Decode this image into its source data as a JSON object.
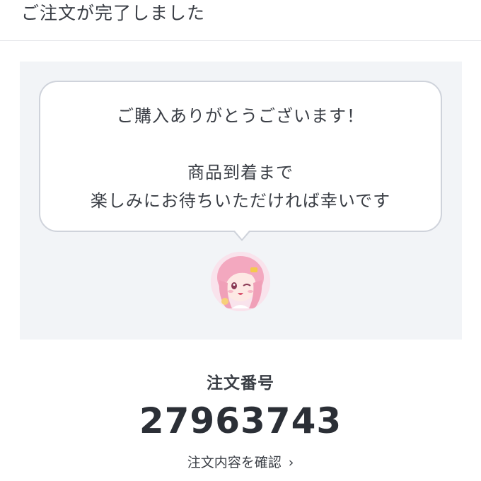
{
  "header": {
    "title": "ご注文が完了しました"
  },
  "message": {
    "line1": "ご購入ありがとうございます！",
    "line2": "商品到着まで",
    "line3": "楽しみにお待ちいただければ幸いです"
  },
  "order": {
    "label": "注文番号",
    "number": "27963743",
    "detail_link": "注文内容を確認",
    "chevron": "›"
  },
  "icons": {
    "avatar": "anime-character-avatar",
    "chevron": "chevron-right-icon"
  },
  "colors": {
    "panel_background": "#f2f4f7",
    "bubble_border": "#cfd3db",
    "text": "#2b2f36",
    "avatar_hair": "#f3a8bf"
  }
}
